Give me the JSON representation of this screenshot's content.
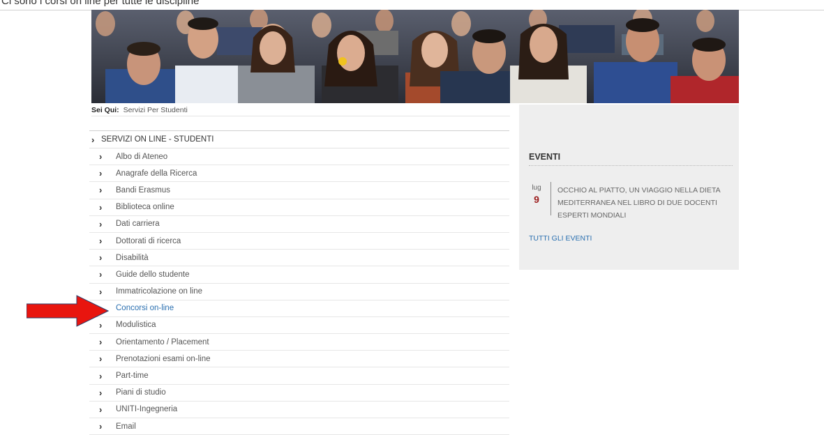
{
  "top_strip": {
    "text": "Ci sono i corsi on line per tutte le discipline"
  },
  "banner": {
    "description_icon": "students-photo"
  },
  "breadcrumb": {
    "label": "Sei Qui:",
    "value": "Servizi Per Studenti"
  },
  "menu": {
    "header": "SERVIZI ON LINE - STUDENTI",
    "items": [
      {
        "label": "Albo di Ateneo",
        "active": false
      },
      {
        "label": "Anagrafe della Ricerca",
        "active": false
      },
      {
        "label": "Bandi Erasmus",
        "active": false
      },
      {
        "label": "Biblioteca online",
        "active": false
      },
      {
        "label": "Dati carriera",
        "active": false
      },
      {
        "label": "Dottorati di ricerca",
        "active": false
      },
      {
        "label": "Disabilità",
        "active": false
      },
      {
        "label": "Guide dello studente",
        "active": false
      },
      {
        "label": "Immatricolazione on line",
        "active": false
      },
      {
        "label": "Concorsi on-line",
        "active": true
      },
      {
        "label": "Modulistica",
        "active": false
      },
      {
        "label": "Orientamento / Placement",
        "active": false
      },
      {
        "label": "Prenotazioni esami on-line",
        "active": false
      },
      {
        "label": "Part-time",
        "active": false
      },
      {
        "label": "Piani di studio",
        "active": false
      },
      {
        "label": "UNITI-Ingegneria",
        "active": false
      },
      {
        "label": "Email",
        "active": false
      }
    ]
  },
  "sidebar": {
    "events_title": "EVENTI",
    "event": {
      "month": "lug",
      "day": "9",
      "text": "OCCHIO AL PIATTO, UN VIAGGIO NELLA DIETA MEDITERRANEA NEL LIBRO DI DUE DOCENTI ESPERTI MONDIALI"
    },
    "all_events_link": "TUTTI GLI EVENTI"
  },
  "colors": {
    "link_blue": "#2a6fb0",
    "event_day_red": "#9b1c1c",
    "arrow_red": "#e8150f",
    "sidebar_bg": "#eeeeee"
  }
}
